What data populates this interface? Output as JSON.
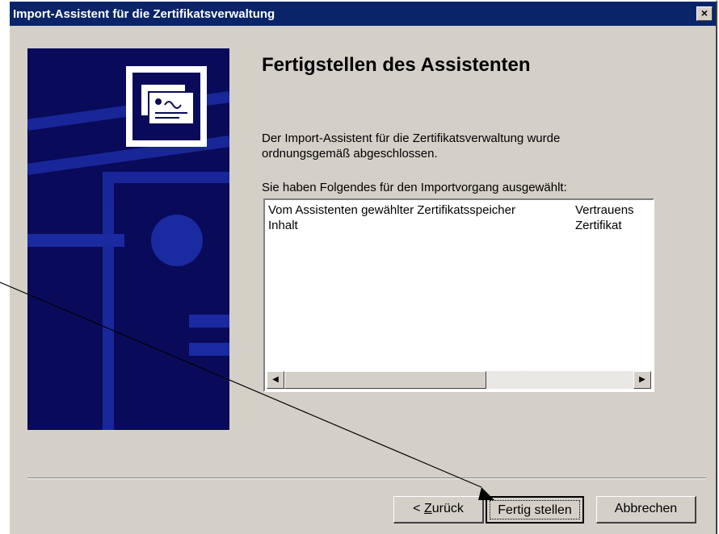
{
  "window": {
    "title": "Import-Assistent für die Zertifikatsverwaltung",
    "close_label": "×"
  },
  "main": {
    "heading": "Fertigstellen des Assistenten",
    "completion_text_line1": "Der Import-Assistent für die Zertifikatsverwaltung wurde",
    "completion_text_line2": "ordnungsgemäß abgeschlossen.",
    "selection_label": "Sie haben Folgendes für den Importvorgang ausgewählt:",
    "summary_rows": [
      {
        "key": "Vom Assistenten gewählter Zertifikatsspeicher",
        "value": "Vertrauens"
      },
      {
        "key": "Inhalt",
        "value": "Zertifikat"
      }
    ],
    "scroll_left": "◀",
    "scroll_right": "▶"
  },
  "buttons": {
    "back_prefix": "< ",
    "back_mnemonic": "Z",
    "back_rest": "urück",
    "finish": "Fertig stellen",
    "cancel": "Abbrechen"
  },
  "icons": {
    "wizard_art": "certificate-icon",
    "close": "close-icon"
  },
  "colors": {
    "titlebar": "#0a246a",
    "dialog_bg": "#d4d0c8",
    "side_art_bg": "#0a0a5a"
  }
}
